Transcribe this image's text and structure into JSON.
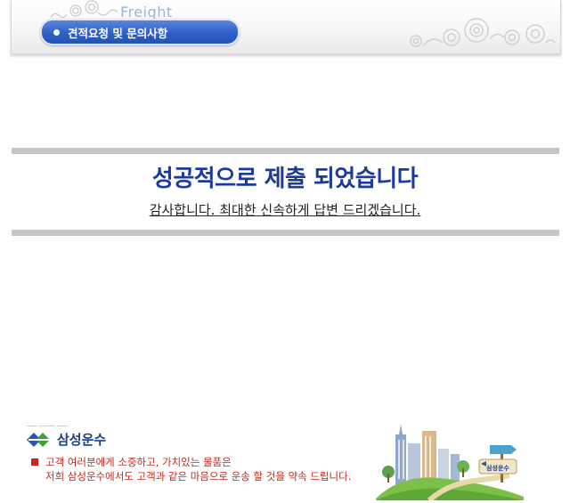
{
  "header": {
    "watermark": "Freight",
    "section_label": "견적요청 및 문의사항"
  },
  "message": {
    "headline": "성공적으로 제출 되었습니다",
    "subline": "감사합니다. 최대한 신속하게 답변 드리겠습니다."
  },
  "footer": {
    "company_name": "삼성운수",
    "line1": "고객 여러분에게 소중하고, 가치있는 물품은",
    "line2": "저희 삼성운수에서도 고객과 같은 마음으로 운송 할 것을 약속 드립니다.",
    "sign_text": "삼성운수"
  },
  "colors": {
    "pill": "#2f5fc8",
    "headline": "#1c3a9b",
    "footer_text": "#c4281e"
  }
}
